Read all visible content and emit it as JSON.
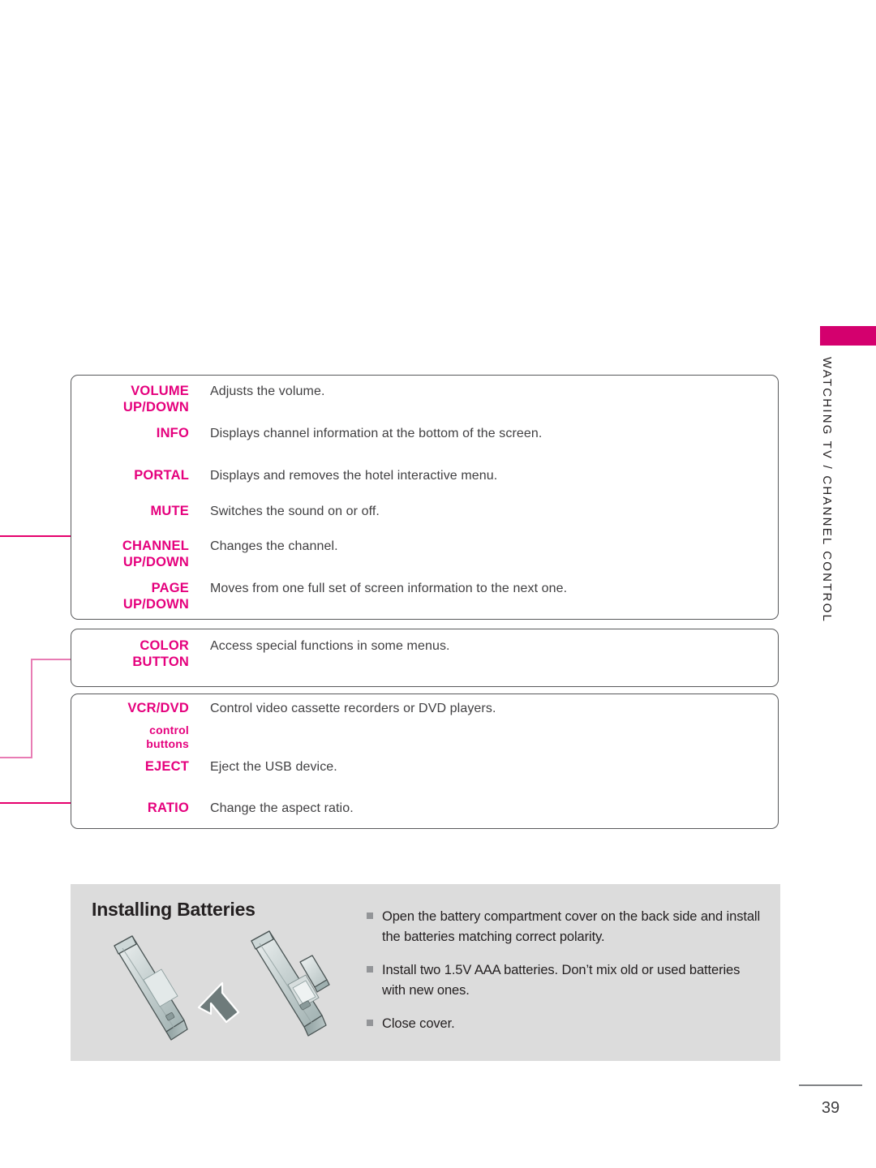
{
  "running_head": {
    "label": "WATCHING TV / CHANNEL CONTROL",
    "tab_color": "#d4006e"
  },
  "colors": {
    "key_pink": "#e5007d",
    "connector_pink": "#e5006d",
    "connector_light_pink": "#e87cb4",
    "panel_gray": "#dcdcdc",
    "body_text": "#414042"
  },
  "remote_table": {
    "groups": [
      {
        "name": "main",
        "rows": [
          {
            "key": "VOLUME\nUP/DOWN",
            "key_line1": "VOLUME",
            "key_line2": "UP/DOWN",
            "desc": "Adjusts the volume."
          },
          {
            "key_line1": "INFO",
            "key_line2": "",
            "desc": "Displays channel information at the bottom of the screen."
          },
          {
            "key_line1": "PORTAL",
            "key_line2": "",
            "desc": "Displays and removes the hotel interactive menu."
          },
          {
            "key_line1": "MUTE",
            "key_line2": "",
            "desc": "Switches the sound on or off."
          },
          {
            "key_line1": "CHANNEL",
            "key_line2": "UP/DOWN",
            "desc": "Changes the channel."
          },
          {
            "key_line1": "PAGE",
            "key_line2": "UP/DOWN",
            "desc": "Moves from one full set of screen information to the next one."
          }
        ]
      },
      {
        "name": "color",
        "rows": [
          {
            "key_line1": "COLOR",
            "key_line2": "BUTTON",
            "desc": "Access special functions in some menus."
          }
        ]
      },
      {
        "name": "vcr",
        "rows": [
          {
            "key_line1": "VCR/DVD",
            "key_line2": "",
            "desc": "Control video cassette recorders or DVD players."
          },
          {
            "key_line1": "control",
            "key_line2": "buttons",
            "desc": ""
          },
          {
            "key_line1": "EJECT",
            "key_line2": "",
            "desc": "Eject the USB device."
          },
          {
            "key_line1": "RATIO",
            "key_line2": "",
            "desc": "Change the aspect ratio."
          }
        ]
      }
    ]
  },
  "battery_section": {
    "title": "Installing Batteries",
    "items": [
      "Open the battery compartment cover on the back side and install the batteries matching correct polarity.",
      "Install two 1.5V AAA batteries. Don’t mix old or used batteries with new ones.",
      "Close cover."
    ]
  },
  "footer": {
    "page_number": "39"
  }
}
